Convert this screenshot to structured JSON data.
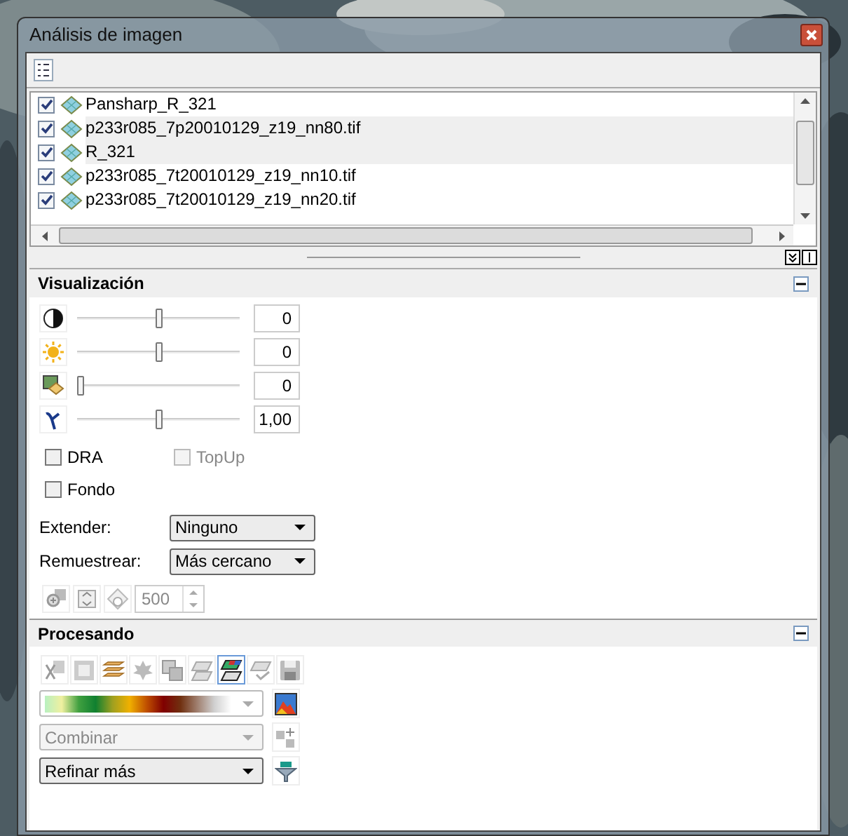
{
  "window": {
    "title": "Análisis de imagen"
  },
  "layers": [
    {
      "name": "Pansharp_R_321",
      "checked": true,
      "selected": false
    },
    {
      "name": "p233r085_7p20010129_z19_nn80.tif",
      "checked": true,
      "selected": true
    },
    {
      "name": "R_321",
      "checked": true,
      "selected": true
    },
    {
      "name": "p233r085_7t20010129_z19_nn10.tif",
      "checked": true,
      "selected": false
    },
    {
      "name": "p233r085_7t20010129_z19_nn20.tif",
      "checked": true,
      "selected": false
    }
  ],
  "visualization": {
    "title": "Visualización",
    "expanded": true,
    "sliders": [
      {
        "kind": "contrast",
        "level": 0.5,
        "value": "0"
      },
      {
        "kind": "brightness",
        "level": 0.5,
        "value": "0"
      },
      {
        "kind": "sharpen",
        "level": 0.0,
        "value": "0"
      },
      {
        "kind": "gamma",
        "level": 0.5,
        "value": "1,00"
      }
    ],
    "checkboxes": [
      {
        "label": "DRA",
        "checked": false,
        "disabled": false
      },
      {
        "label": "TopUp",
        "checked": false,
        "disabled": true
      },
      {
        "label": "Fondo",
        "checked": false,
        "disabled": false
      }
    ],
    "extend": {
      "label": "Extender:",
      "value": "Ninguno"
    },
    "resample": {
      "label": "Remuestrear:",
      "value": "Más cercano"
    },
    "tile_size": {
      "value": "500",
      "disabled": true
    }
  },
  "processing": {
    "title": "Procesando",
    "expanded": true,
    "tools": [
      {
        "kind": "clip",
        "selected": false
      },
      {
        "kind": "frame",
        "selected": false
      },
      {
        "kind": "layers",
        "selected": false
      },
      {
        "kind": "leaf",
        "selected": false
      },
      {
        "kind": "overlay",
        "selected": false
      },
      {
        "kind": "grid",
        "selected": false
      },
      {
        "kind": "colorgrid",
        "selected": true
      },
      {
        "kind": "gridcheck",
        "selected": false
      },
      {
        "kind": "save",
        "selected": false
      }
    ],
    "combine": {
      "value": "Combinar",
      "disabled": true
    },
    "refine": {
      "value": "Refinar más",
      "disabled": false
    }
  }
}
